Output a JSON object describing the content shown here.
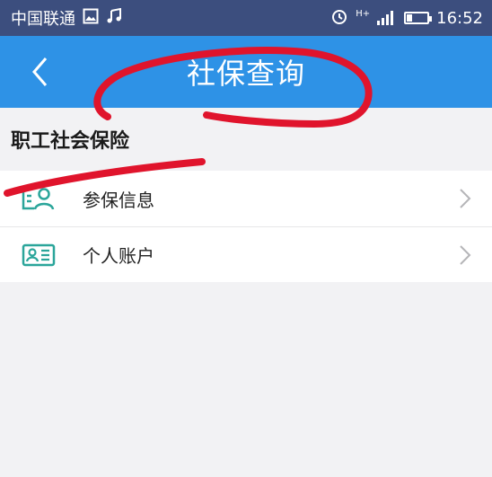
{
  "status_bar": {
    "carrier": "中国联通",
    "time": "16:52",
    "network": "H+",
    "icons": [
      "image-icon",
      "music-note-icon",
      "alarm-icon",
      "signal-icon",
      "battery-icon"
    ]
  },
  "nav": {
    "title": "社保查询",
    "back_icon": "chevron-left-icon"
  },
  "section": {
    "title": "职工社会保险"
  },
  "list": {
    "items": [
      {
        "label": "参保信息",
        "icon": "person-id-icon"
      },
      {
        "label": "个人账户",
        "icon": "account-card-icon"
      }
    ]
  },
  "colors": {
    "status_bar": "#3c4e7e",
    "nav_bar": "#2e92e6",
    "icon_teal": "#2aa59a",
    "scribble_red": "#e0142c",
    "background": "#f2f2f4"
  }
}
